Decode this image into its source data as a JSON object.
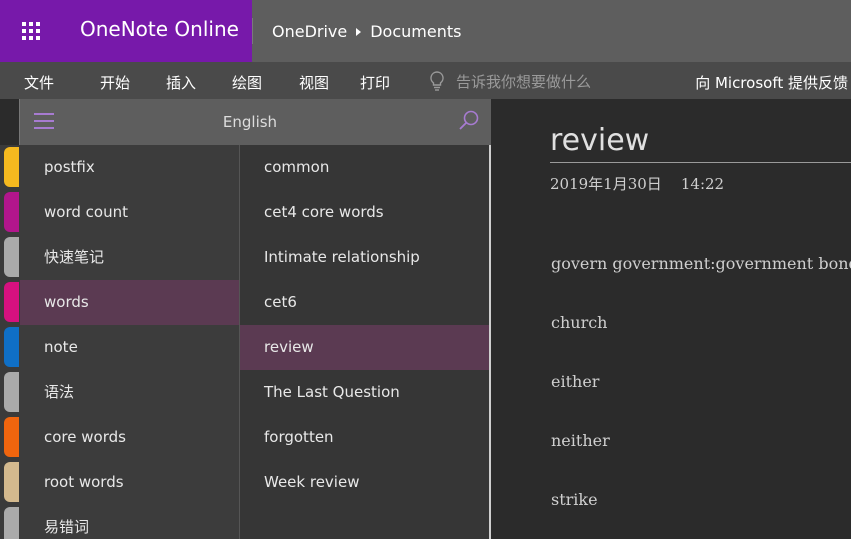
{
  "header": {
    "app_title": "OneNote Online",
    "breadcrumb": [
      "OneDrive",
      "Documents"
    ]
  },
  "menu": {
    "items": [
      "文件",
      "开始",
      "插入",
      "绘图",
      "视图",
      "打印"
    ],
    "tell_me_placeholder": "告诉我你想要做什么",
    "feedback": "向 Microsoft 提供反馈"
  },
  "nav": {
    "notebook_name": "English",
    "sections": [
      {
        "label": "postfix",
        "color": "#f5b91f"
      },
      {
        "label": "word count",
        "color": "#b2168c"
      },
      {
        "label": "快速笔记",
        "color": "#aaaaaa"
      },
      {
        "label": "words",
        "color": "#d6117f",
        "selected": true
      },
      {
        "label": "note",
        "color": "#0f6fc6"
      },
      {
        "label": "语法",
        "color": "#aaaaaa"
      },
      {
        "label": "core words",
        "color": "#f0650e"
      },
      {
        "label": "root words",
        "color": "#d3b98e"
      },
      {
        "label": "易错词",
        "color": "#aaaaaa"
      }
    ],
    "pages": [
      {
        "label": "common"
      },
      {
        "label": "cet4 core words"
      },
      {
        "label": "Intimate relationship"
      },
      {
        "label": "cet6"
      },
      {
        "label": "review",
        "selected": true
      },
      {
        "label": "The Last Question"
      },
      {
        "label": "forgotten"
      },
      {
        "label": "Week review"
      }
    ]
  },
  "page": {
    "title": "review",
    "date": "2019年1月30日    14:22",
    "lines": [
      "govern government:government bond",
      "church",
      "either",
      "neither",
      "strike"
    ]
  },
  "colors": {
    "brand": "#7719aa",
    "selected_row": "#5b3a52",
    "accent_icon": "#a77bd1"
  }
}
